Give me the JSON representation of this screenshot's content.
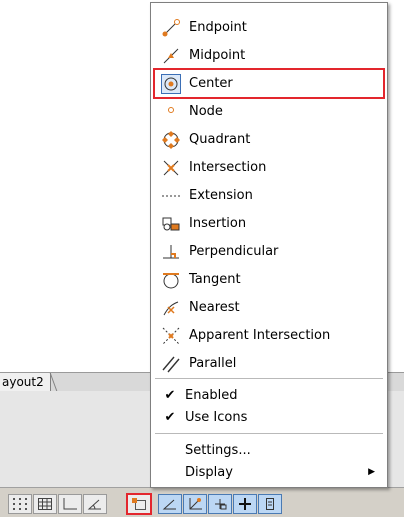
{
  "osnap_menu": {
    "items": [
      {
        "label": "Endpoint",
        "icon": "endpoint-icon"
      },
      {
        "label": "Midpoint",
        "icon": "midpoint-icon"
      },
      {
        "label": "Center",
        "icon": "center-icon",
        "selected": true
      },
      {
        "label": "Node",
        "icon": "node-icon"
      },
      {
        "label": "Quadrant",
        "icon": "quadrant-icon"
      },
      {
        "label": "Intersection",
        "icon": "intersection-icon"
      },
      {
        "label": "Extension",
        "icon": "extension-icon"
      },
      {
        "label": "Insertion",
        "icon": "insertion-icon"
      },
      {
        "label": "Perpendicular",
        "icon": "perpendicular-icon"
      },
      {
        "label": "Tangent",
        "icon": "tangent-icon"
      },
      {
        "label": "Nearest",
        "icon": "nearest-icon"
      },
      {
        "label": "Apparent Intersection",
        "icon": "apparent-intersection-icon"
      },
      {
        "label": "Parallel",
        "icon": "parallel-icon"
      }
    ],
    "toggles": [
      {
        "label": "Enabled",
        "checked": true
      },
      {
        "label": "Use Icons",
        "checked": true
      }
    ],
    "settings_label": "Settings...",
    "display_label": "Display"
  },
  "layout_tab": {
    "label": "ayout2"
  },
  "colors": {
    "highlight": "#e3262d",
    "icon_orange": "#e07a1f",
    "toggle_on": "#bcd7f4"
  }
}
